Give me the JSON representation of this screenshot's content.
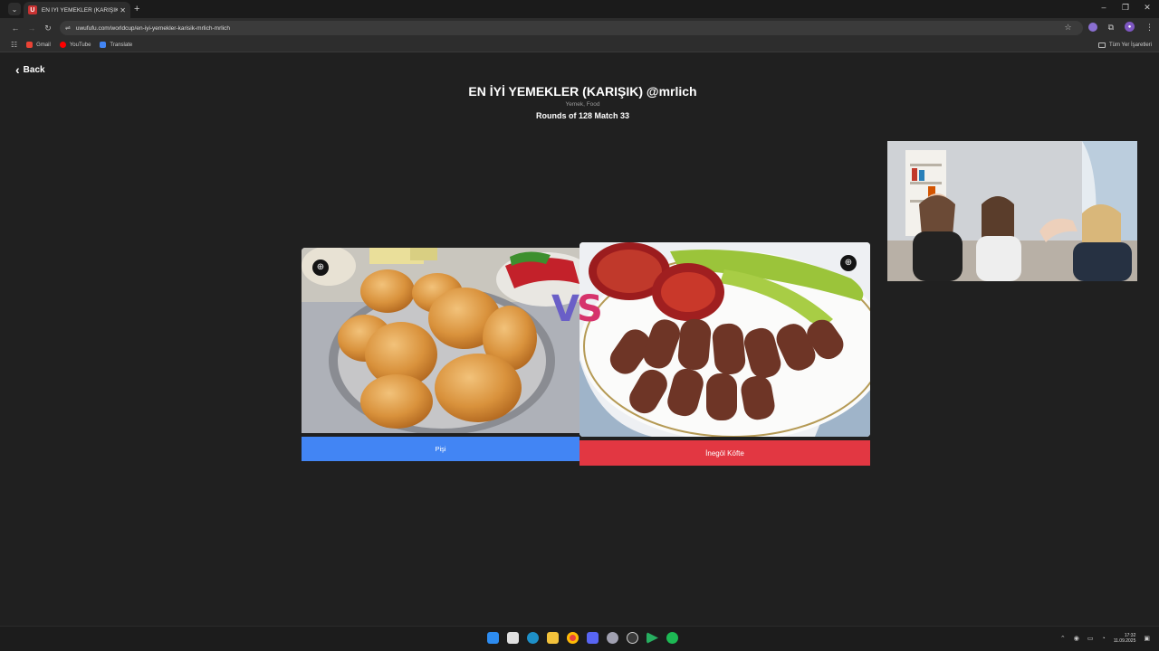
{
  "browser": {
    "tab_title": "EN İYİ YEMEKLER (KARIŞIK) @mrl",
    "tab_favicon_letter": "U",
    "url": "uwufufu.com/worldcup/en-iyi-yemekler-karisik-mrlich-mrlich",
    "bookmarks": [
      {
        "label": "Gmail",
        "color": "#ea4335"
      },
      {
        "label": "YouTube",
        "color": "#ff0000"
      },
      {
        "label": "Translate",
        "color": "#4285f4"
      }
    ],
    "all_bookmarks_label": "Tüm Yer İşaretleri"
  },
  "page": {
    "back_label": "Back",
    "title": "EN İYİ YEMEKLER (KARIŞIK) @mrlich",
    "subtitle": "Yemek, Food",
    "rounds": "Rounds of 128 Match 33",
    "left_choice": {
      "label": "Pişi",
      "color": "#4285f4"
    },
    "right_choice": {
      "label": "İnegöl Köfte",
      "color": "#e23742"
    },
    "vs": {
      "v": "V",
      "s": "S"
    }
  },
  "taskbar": {
    "time": "17:32",
    "date": "11.09.2025"
  },
  "colors": {
    "page_bg": "#202020",
    "chrome_bg": "#2d2d2d",
    "left_accent": "#4285f4",
    "right_accent": "#e23742"
  }
}
